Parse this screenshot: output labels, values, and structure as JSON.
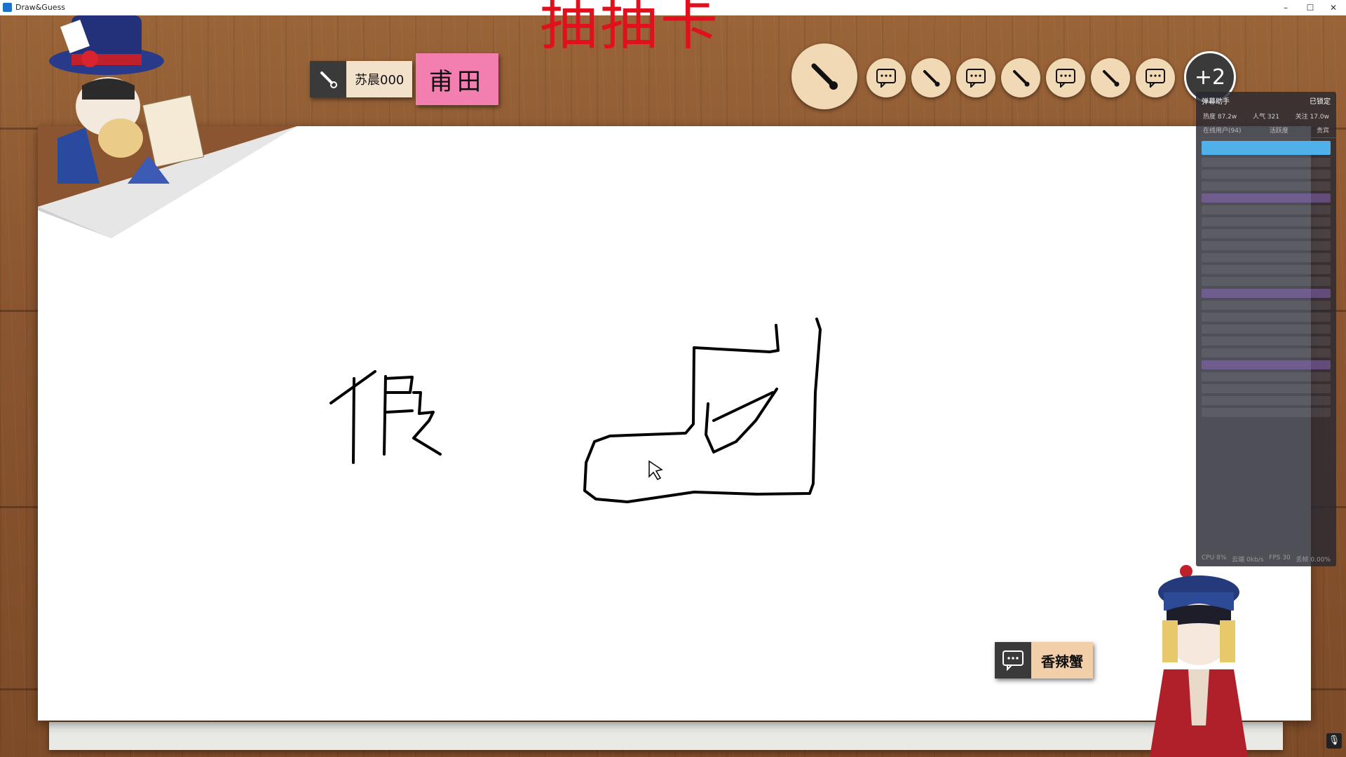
{
  "window": {
    "title": "Draw&Guess"
  },
  "banner": {
    "text": "抽抽卡"
  },
  "drawer": {
    "name": "苏晨000"
  },
  "word_card": {
    "text": "甫田"
  },
  "player_track": {
    "extra_count": "+2"
  },
  "canvas": {
    "handwriting": "假"
  },
  "guess_bubble": {
    "text": "香辣蟹"
  },
  "stream_overlay": {
    "title": "弹幕助手",
    "status": "已锁定",
    "heat": "热度 87.2w",
    "popularity": "人气 321",
    "follow": "关注 17.0w",
    "online": "在线用户(94)",
    "activity": "活跃度",
    "level": "贵宾",
    "footer_cpu": "CPU 8%",
    "footer_net": "云端 0kb/s",
    "footer_fps": "FPS 30",
    "footer_loss": "丢帧 0.00%"
  },
  "colors": {
    "banner": "#e0101c",
    "word_card": "#f37fb0",
    "guess_label": "#f2cfa8",
    "paper": "#ffffff"
  }
}
